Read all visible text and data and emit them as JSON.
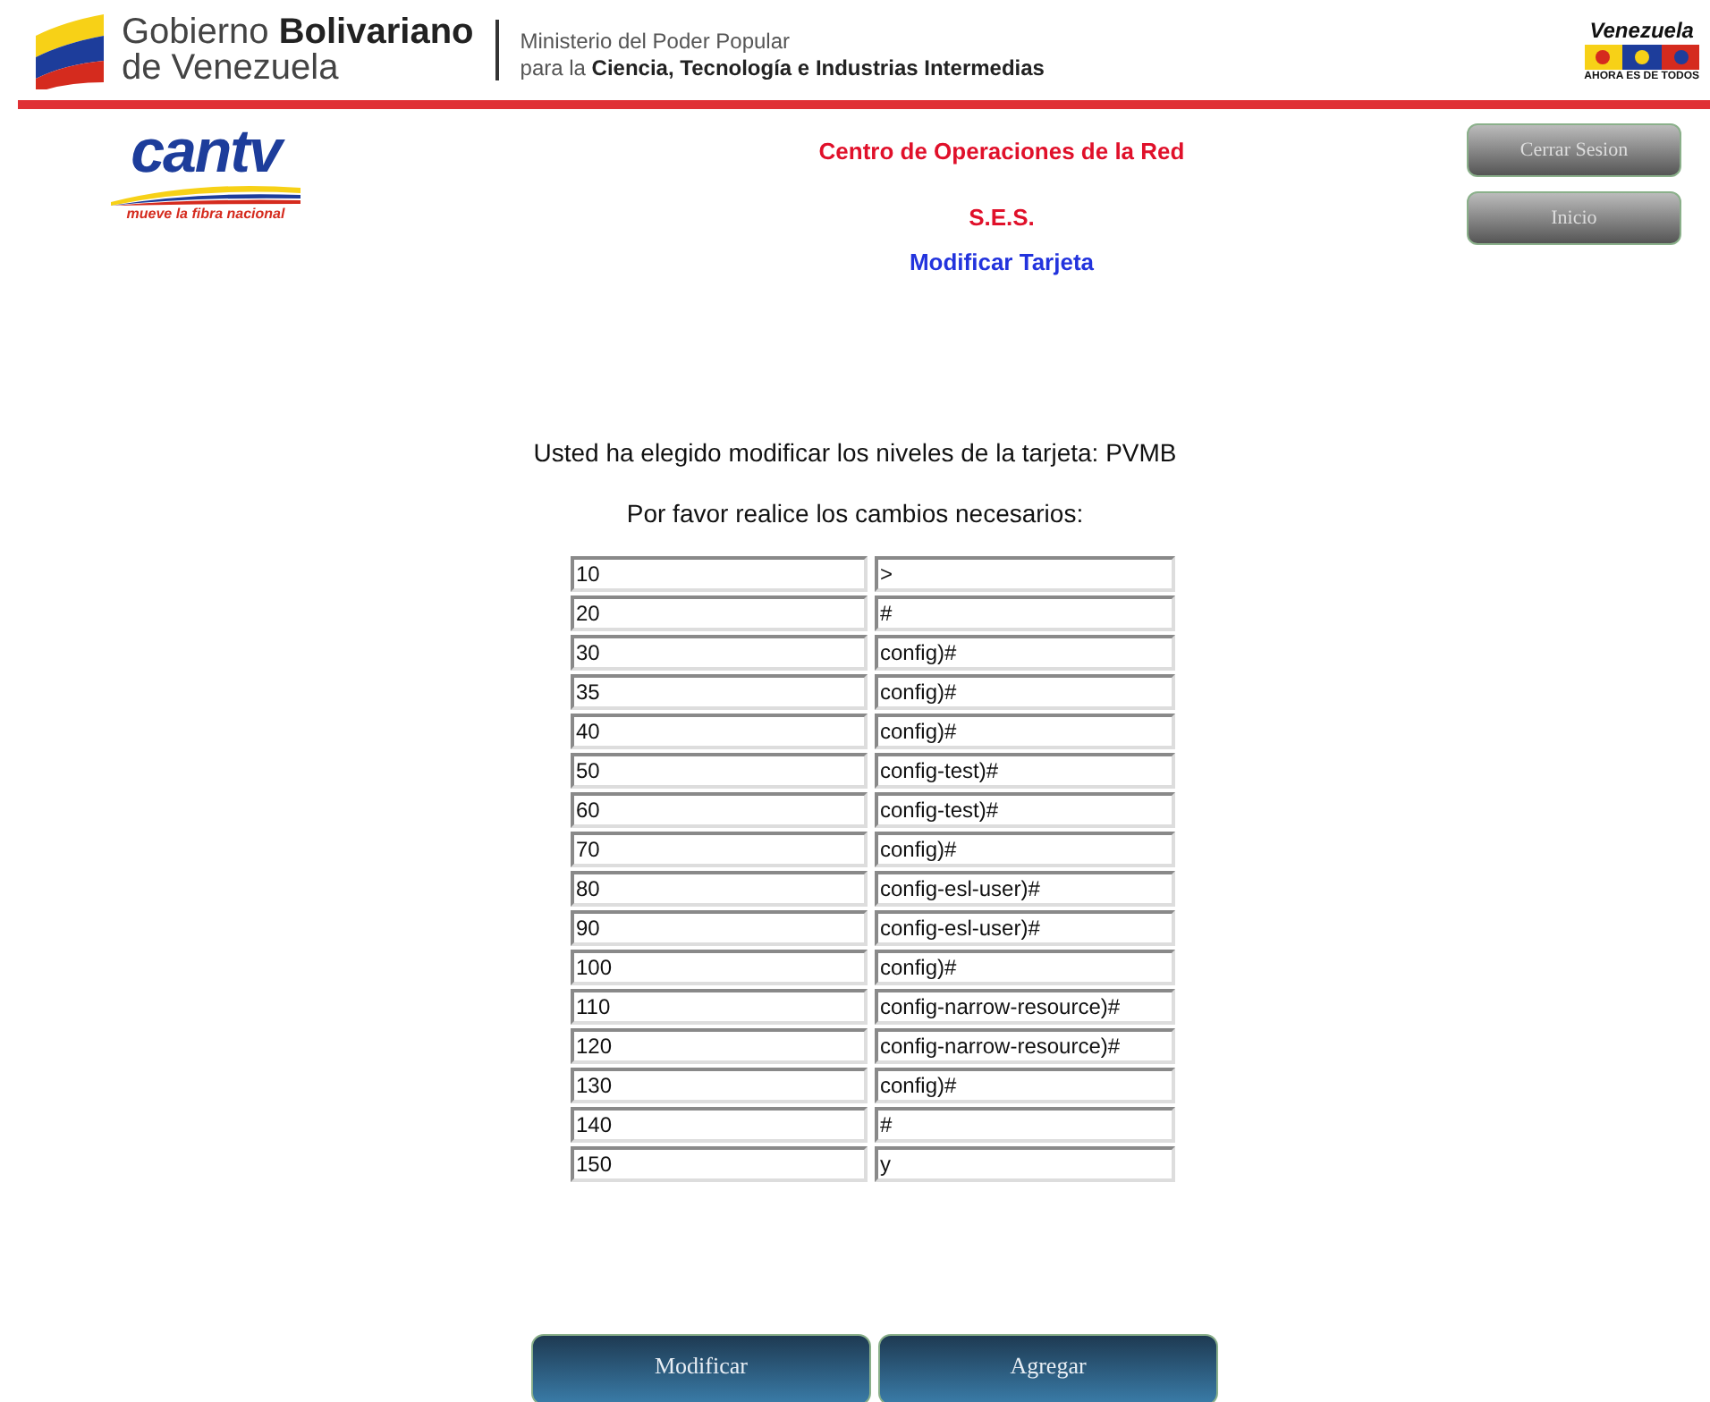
{
  "header": {
    "gov_name_regular": "Gobierno",
    "gov_name_bold": "Bolivariano",
    "gov_name_line2": "de Venezuela",
    "ministry_line1": "Ministerio del Poder Popular",
    "ministry_line2_regular": "para la",
    "ministry_line2_bold": "Ciencia, Tecnología e Industrias Intermedias",
    "badge_title": "Venezuela",
    "badge_slogan": "AHORA ES DE TODOS"
  },
  "brand": {
    "name": "cantv",
    "slogan": "mueve la fibra nacional"
  },
  "titles": {
    "center": "Centro de Operaciones de la Red",
    "system": "S.E.S.",
    "page": "Modificar Tarjeta"
  },
  "nav_buttons": [
    "Cerrar Sesion",
    "Inicio"
  ],
  "intro": "Usted ha elegido modificar los niveles de la tarjeta: PVMB",
  "prompt": "Por favor realice los cambios necesarios:",
  "levels": [
    {
      "level_value": "10",
      "prompt_value": ">"
    },
    {
      "level_value": "20",
      "prompt_value": "#"
    },
    {
      "level_value": "30",
      "prompt_value": "config)#"
    },
    {
      "level_value": "35",
      "prompt_value": "config)#"
    },
    {
      "level_value": "40",
      "prompt_value": "config)#"
    },
    {
      "level_value": "50",
      "prompt_value": "config-test)#"
    },
    {
      "level_value": "60",
      "prompt_value": "config-test)#"
    },
    {
      "level_value": "70",
      "prompt_value": "config)#"
    },
    {
      "level_value": "80",
      "prompt_value": "config-esl-user)#"
    },
    {
      "level_value": "90",
      "prompt_value": "config-esl-user)#"
    },
    {
      "level_value": "100",
      "prompt_value": "config)#"
    },
    {
      "level_value": "110",
      "prompt_value": "config-narrow-resource)#"
    },
    {
      "level_value": "120",
      "prompt_value": "config-narrow-resource)#"
    },
    {
      "level_value": "130",
      "prompt_value": "config)#"
    },
    {
      "level_value": "140",
      "prompt_value": "#"
    },
    {
      "level_value": "150",
      "prompt_value": "y"
    }
  ],
  "action_buttons": [
    "Modificar",
    "Agregar"
  ]
}
